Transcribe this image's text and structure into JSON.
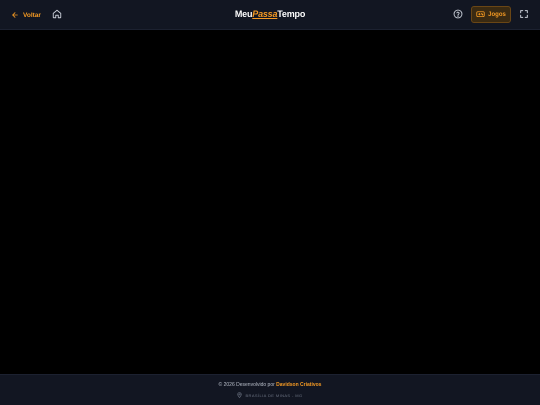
{
  "header": {
    "back_label": "Voltar",
    "logo": {
      "part1": "Meu",
      "part2": "Passa",
      "part3": "Tempo"
    },
    "games_label": "Jogos"
  },
  "footer": {
    "credit_prefix": "© 2026 Desenvolvido por",
    "developer": "Davidson Criativos",
    "location": "BRASÍLIA DE MINAS - MG"
  },
  "icons": {
    "back": "arrow-left-icon",
    "home": "home-icon",
    "help": "help-circle-icon",
    "games": "gamepad-icon",
    "fullscreen": "fullscreen-icon",
    "location": "map-pin-icon"
  },
  "colors": {
    "accent": "#f59a23",
    "bar_background": "#121622",
    "page_background": "#000000",
    "muted_text": "#b9bfca"
  }
}
